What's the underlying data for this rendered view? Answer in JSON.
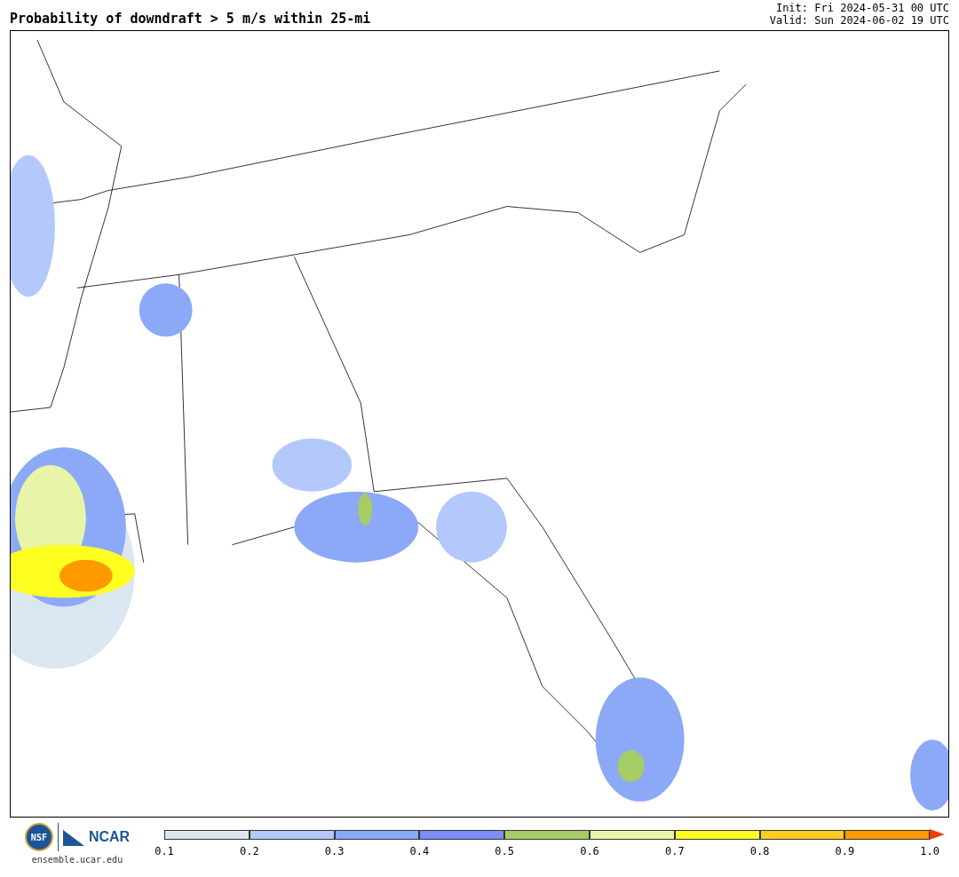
{
  "title": "Probability of downdraft > 5 m/s within 25-mi",
  "init": "Init: Fri 2024-05-31 00 UTC",
  "valid": "Valid: Sun 2024-06-02 19 UTC",
  "logos": {
    "nsf": "NSF",
    "ncar": "NCAR",
    "url": "ensemble.ucar.edu"
  },
  "legend": {
    "segments": [
      {
        "kind": "box",
        "color": "#dbe6f1"
      },
      {
        "kind": "box",
        "color": "#b3c8fb"
      },
      {
        "kind": "box",
        "color": "#8ca9f8"
      },
      {
        "kind": "box",
        "color": "#7a8ef5"
      },
      {
        "kind": "box",
        "color": "#a6cc66"
      },
      {
        "kind": "box",
        "color": "#e8f5a8"
      },
      {
        "kind": "box",
        "color": "#ffff22"
      },
      {
        "kind": "box",
        "color": "#ffcc22"
      },
      {
        "kind": "box",
        "color": "#ff9900"
      },
      {
        "kind": "arrow",
        "color": "#e84010"
      }
    ],
    "ticks": [
      "0.1",
      "0.2",
      "0.3",
      "0.4",
      "0.5",
      "0.6",
      "0.7",
      "0.8",
      "0.9",
      "1.0"
    ]
  }
}
